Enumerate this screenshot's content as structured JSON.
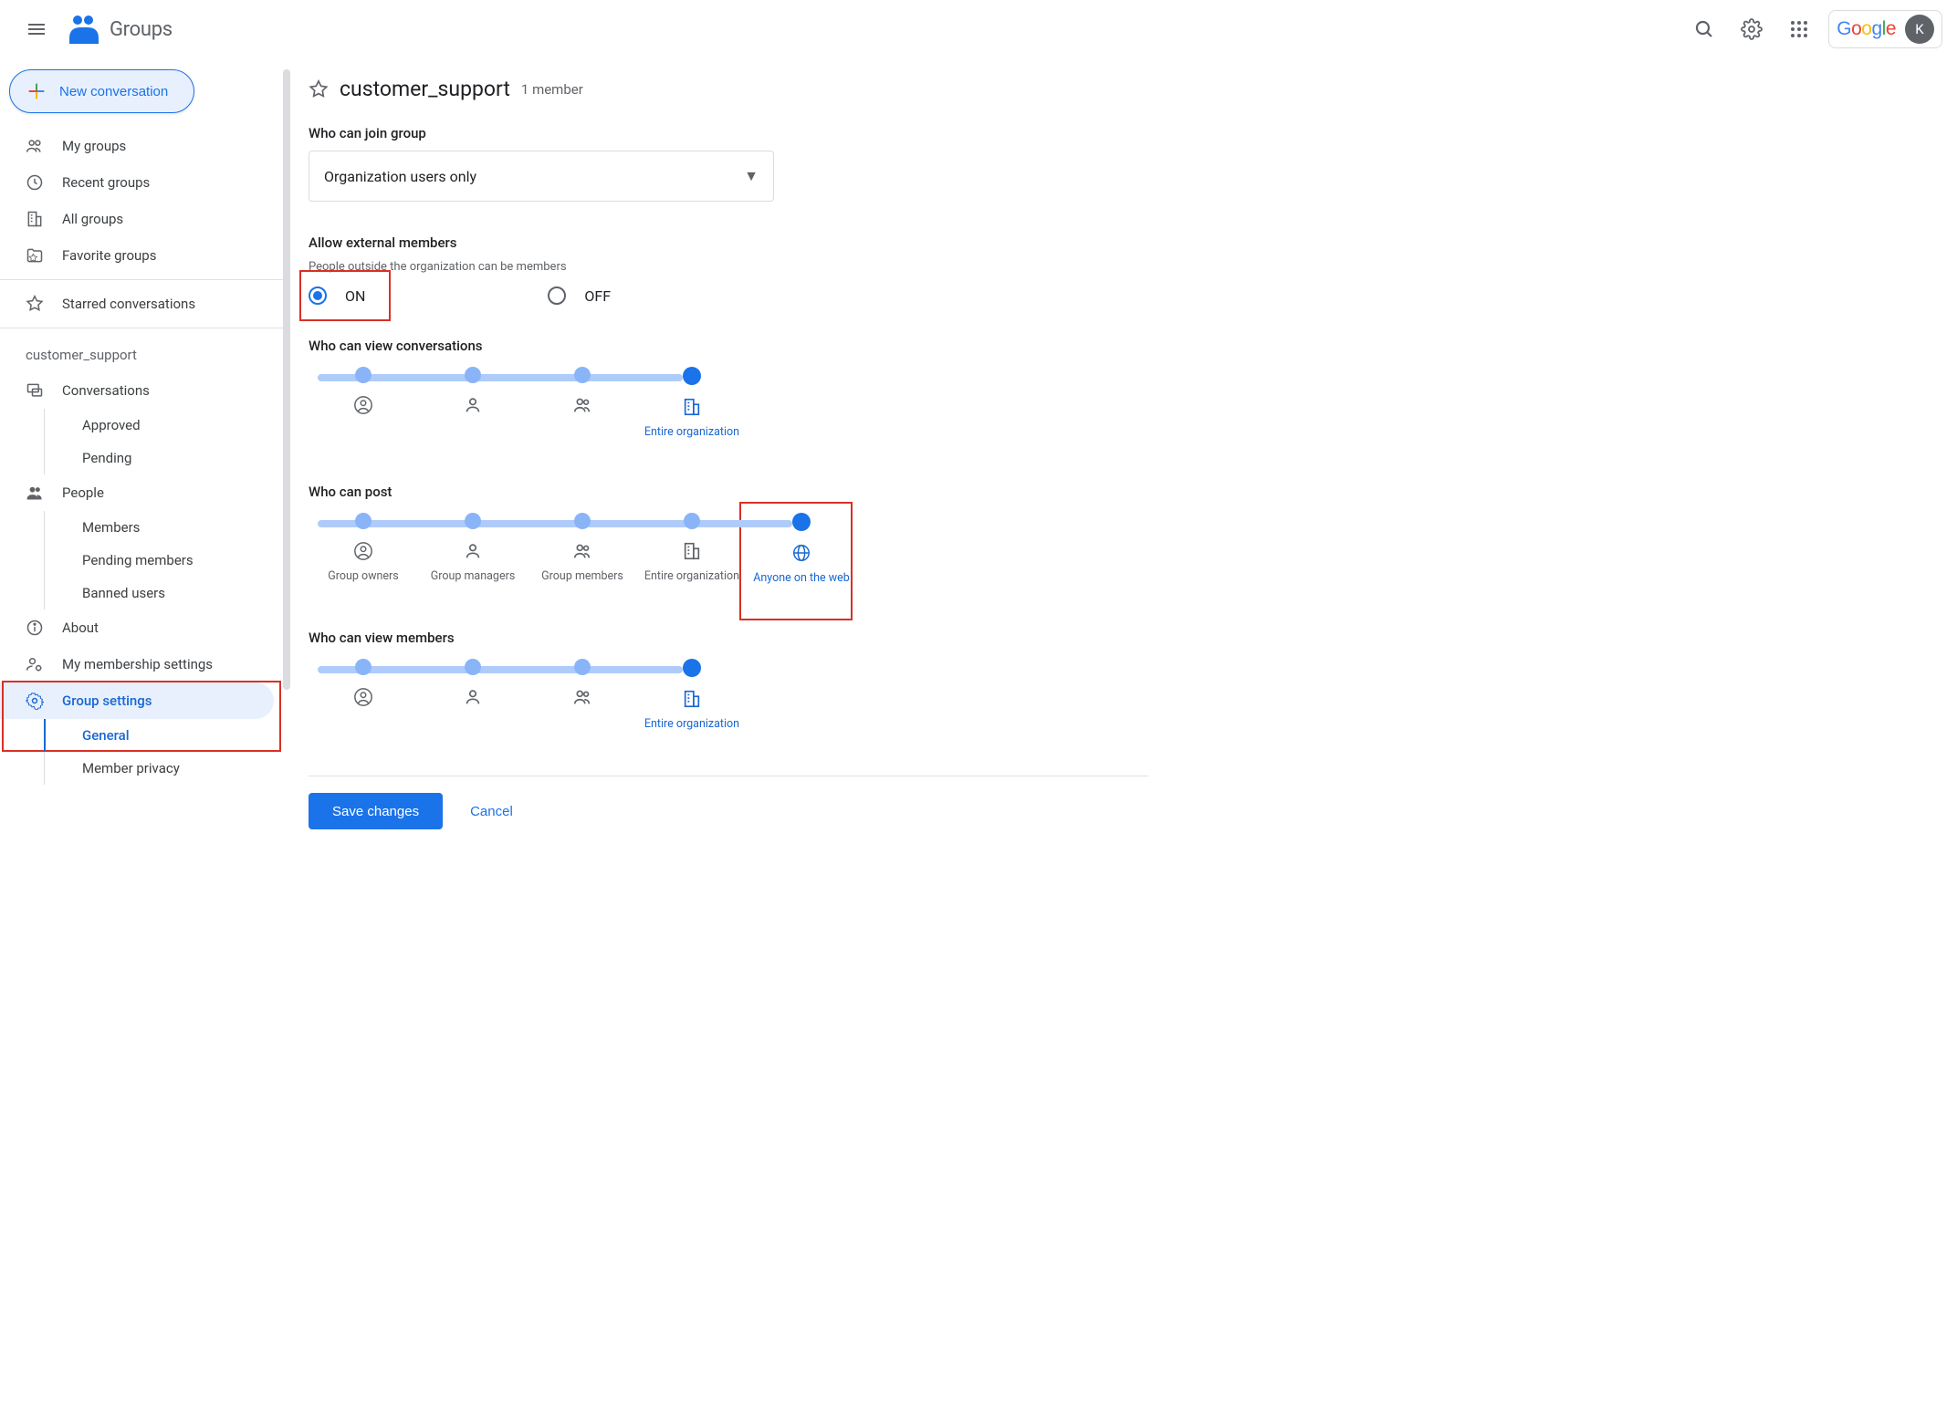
{
  "app": {
    "name": "Groups"
  },
  "header": {
    "google_label": "Google",
    "avatar_initial": "K"
  },
  "new_conversation_label": "New conversation",
  "nav": {
    "my_groups": "My groups",
    "recent_groups": "Recent groups",
    "all_groups": "All groups",
    "favorite_groups": "Favorite groups",
    "starred_conversations": "Starred conversations"
  },
  "group_context": {
    "name": "customer_support",
    "conversations": "Conversations",
    "approved": "Approved",
    "pending": "Pending",
    "people": "People",
    "members": "Members",
    "pending_members": "Pending members",
    "banned_users": "Banned users",
    "about": "About",
    "my_membership": "My membership settings",
    "group_settings": "Group settings",
    "general": "General",
    "member_privacy": "Member privacy"
  },
  "page": {
    "group_name": "customer_support",
    "member_count": "1 member"
  },
  "join": {
    "label": "Who can join group",
    "selected": "Organization users only"
  },
  "external": {
    "label": "Allow external members",
    "sub": "People outside the organization can be members",
    "on_label": "ON",
    "off_label": "OFF",
    "value": "ON"
  },
  "view_conversations": {
    "label": "Who can view conversations",
    "selected_index": 3,
    "steps": [
      {
        "label": ""
      },
      {
        "label": ""
      },
      {
        "label": ""
      },
      {
        "label": "Entire organization"
      }
    ]
  },
  "post": {
    "label": "Who can post",
    "selected_index": 4,
    "steps": [
      {
        "label": "Group owners"
      },
      {
        "label": "Group managers"
      },
      {
        "label": "Group members"
      },
      {
        "label": "Entire organization"
      },
      {
        "label": "Anyone on the web"
      }
    ]
  },
  "view_members": {
    "label": "Who can view members",
    "selected_index": 3,
    "steps": [
      {
        "label": ""
      },
      {
        "label": ""
      },
      {
        "label": ""
      },
      {
        "label": "Entire organization"
      }
    ]
  },
  "footer": {
    "save": "Save changes",
    "cancel": "Cancel"
  }
}
